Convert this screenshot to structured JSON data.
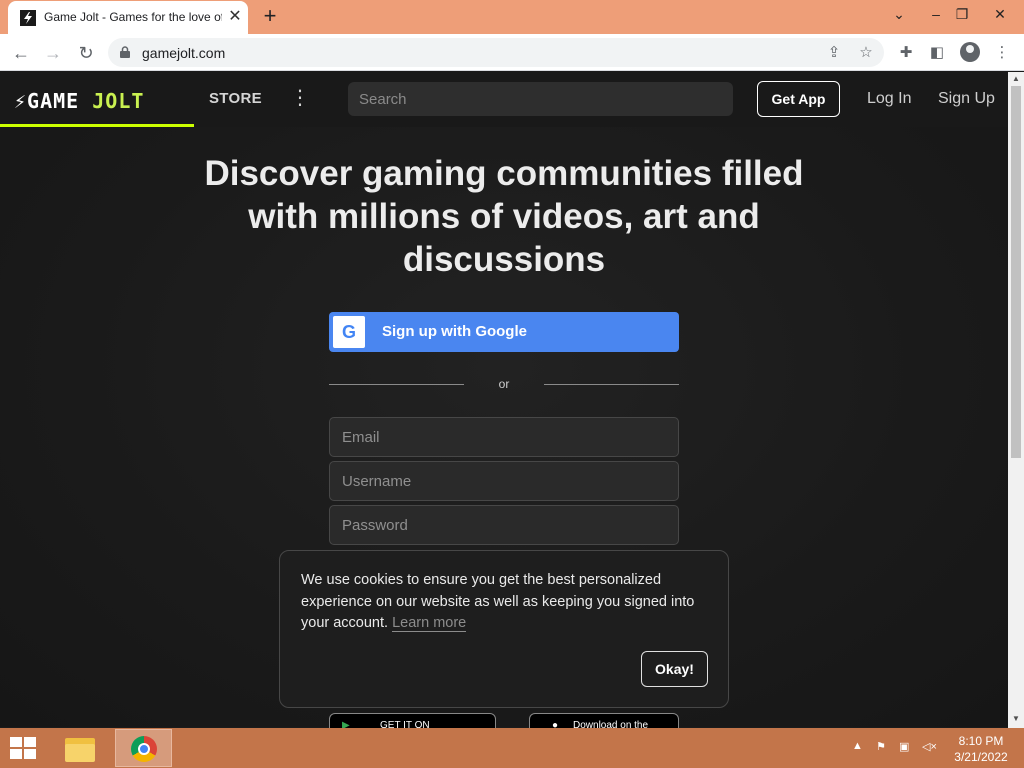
{
  "browser": {
    "tab_title": "Game Jolt - Games for the love of",
    "tab_close": "✕",
    "new_tab": "+",
    "url": "gamejolt.com",
    "window_controls": {
      "chevron": "⌄",
      "minimize": "–",
      "restore": "❐",
      "close": "✕"
    }
  },
  "site": {
    "logo_text_a": "GAME",
    "logo_text_b": "JOLT",
    "store_label": "STORE",
    "search_placeholder": "Search",
    "get_app_label": "Get App",
    "login_label": "Log In",
    "signup_label": "Sign Up"
  },
  "hero": {
    "headline": "Discover gaming communities filled with millions of videos, art and discussions"
  },
  "signup_form": {
    "google_label": "Sign up with Google",
    "google_glyph": "G",
    "or_label": "or",
    "email_placeholder": "Email",
    "username_placeholder": "Username",
    "password_placeholder": "Password"
  },
  "store_badges": {
    "google_play": "GET IT ON",
    "app_store": "Download on the"
  },
  "cookie_banner": {
    "message": "We use cookies to ensure you get the best personalized experience on our website as well as keeping you signed into your account.",
    "learn_more": "Learn more",
    "okay_label": "Okay!"
  },
  "taskbar": {
    "time": "8:10 PM",
    "date": "3/21/2022"
  },
  "colors": {
    "accent": "#ccff00",
    "google_blue": "#4a86f0",
    "taskbar": "#c3754a"
  }
}
